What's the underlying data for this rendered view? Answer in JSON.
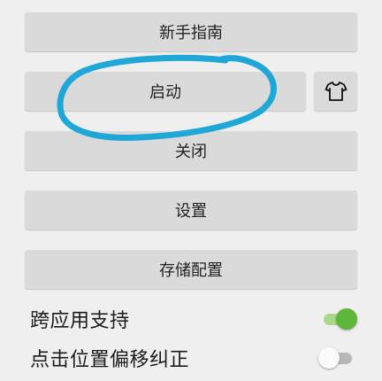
{
  "buttons": {
    "guide": "新手指南",
    "start": "启动",
    "close": "关闭",
    "settings": "设置",
    "storage": "存储配置"
  },
  "icons": {
    "skin": "tshirt-icon"
  },
  "toggles": [
    {
      "label": "跨应用支持",
      "on": true
    },
    {
      "label": "点击位置偏移纠正",
      "on": false
    }
  ],
  "colors": {
    "background": "#efefef",
    "button": "#d9dad9",
    "toggle_on": "#5fb73a",
    "annotation": "#1fa7d8"
  }
}
